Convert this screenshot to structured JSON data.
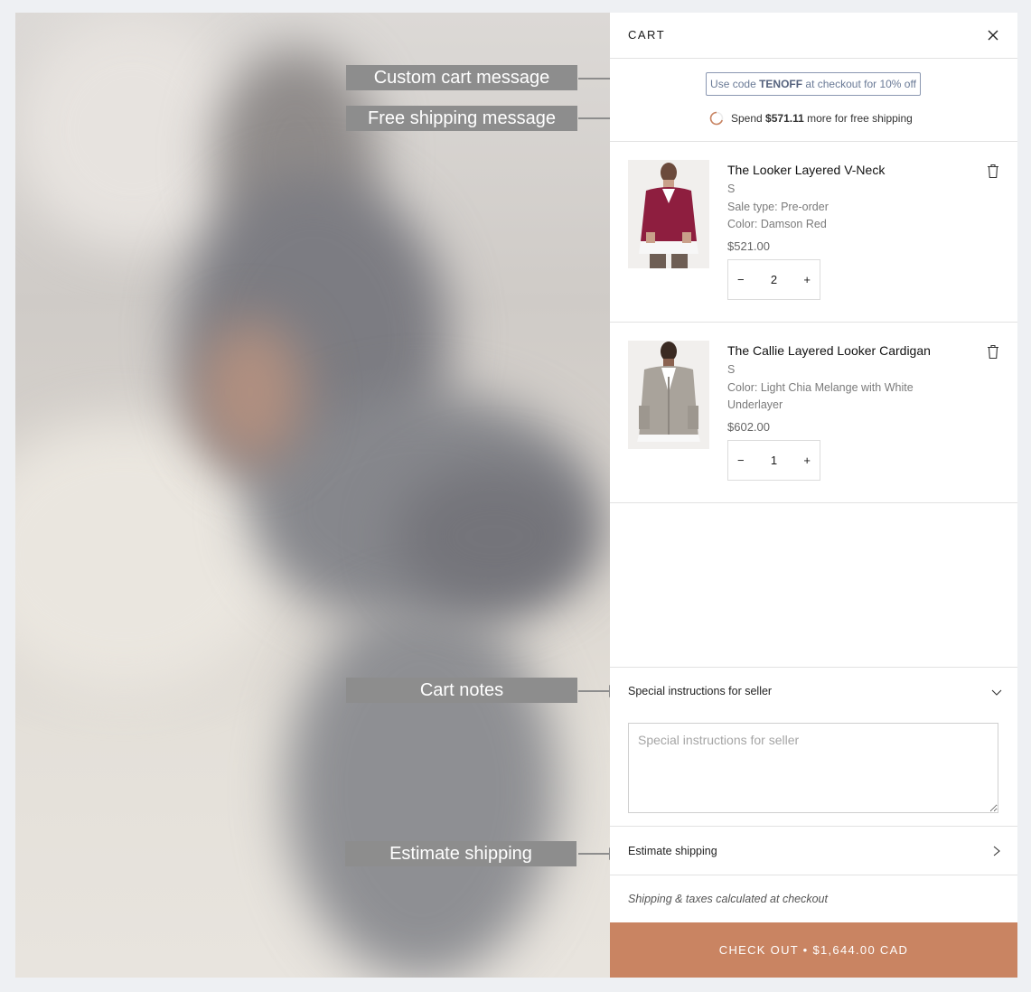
{
  "annotations": {
    "custom_cart_message": "Custom cart message",
    "free_shipping_message": "Free shipping message",
    "cart_notes": "Cart notes",
    "estimate_shipping": "Estimate shipping"
  },
  "cart": {
    "title": "CART",
    "promo": {
      "prefix": "Use code ",
      "code": "TENOFF",
      "suffix": " at checkout for 10% off"
    },
    "shipping": {
      "prefix": "Spend ",
      "amount": "$571.11",
      "suffix": " more for free shipping"
    },
    "items": [
      {
        "name": "The Looker Layered V-Neck",
        "size": "S",
        "meta1": "Sale type: Pre-order",
        "meta2": "Color: Damson Red",
        "price": "$521.00",
        "qty": "2"
      },
      {
        "name": "The Callie Layered Looker Cardigan",
        "size": "S",
        "meta1": "Color: Light Chia Melange with White Underlayer",
        "meta2": "",
        "price": "$602.00",
        "qty": "1"
      }
    ],
    "qty_minus": "−",
    "qty_plus": "+",
    "notes_label": "Special instructions for seller",
    "notes_placeholder": "Special instructions for seller",
    "estimate_label": "Estimate shipping",
    "taxes_note": "Shipping & taxes calculated at checkout",
    "checkout_label": "CHECK OUT • $1,644.00 CAD"
  },
  "colors": {
    "accent": "#c98462",
    "promo_border": "#8a97b1",
    "annotation": "#8d8d8d",
    "spinner": "#c98462"
  },
  "icons": {
    "close": "close-icon",
    "trash": "trash-icon",
    "spinner": "progress-ring-icon",
    "chevron_down": "chevron-down-icon",
    "chevron_right": "chevron-right-icon"
  }
}
